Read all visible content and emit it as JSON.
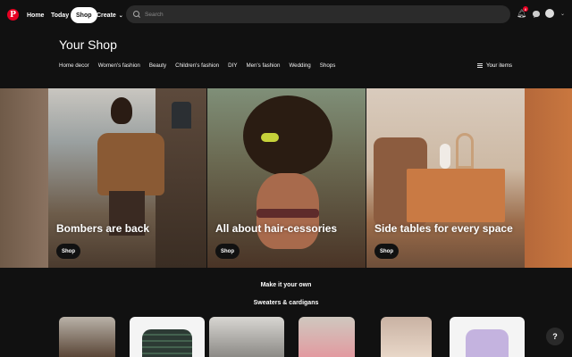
{
  "nav": {
    "home": "Home",
    "today": "Today",
    "shop": "Shop",
    "create": "Create",
    "search_placeholder": "Search",
    "notifications_count": "8"
  },
  "shop": {
    "title": "Your Shop",
    "categories": [
      "Home decor",
      "Women's fashion",
      "Beauty",
      "Children's fashion",
      "DIY",
      "Men's fashion",
      "Wedding",
      "Shops"
    ],
    "your_items": "Your items"
  },
  "hero": [
    {
      "label": "Bombers are back",
      "button": "Shop"
    },
    {
      "label": "All about hair-cessories",
      "button": "Shop"
    },
    {
      "label": "Side tables for every space",
      "button": "Shop"
    }
  ],
  "sections": {
    "make_it_your_own": "Make it your own",
    "sweaters": "Sweaters & cardigans"
  },
  "help": "?",
  "colors": {
    "brand": "#e60023",
    "background": "#111111"
  }
}
